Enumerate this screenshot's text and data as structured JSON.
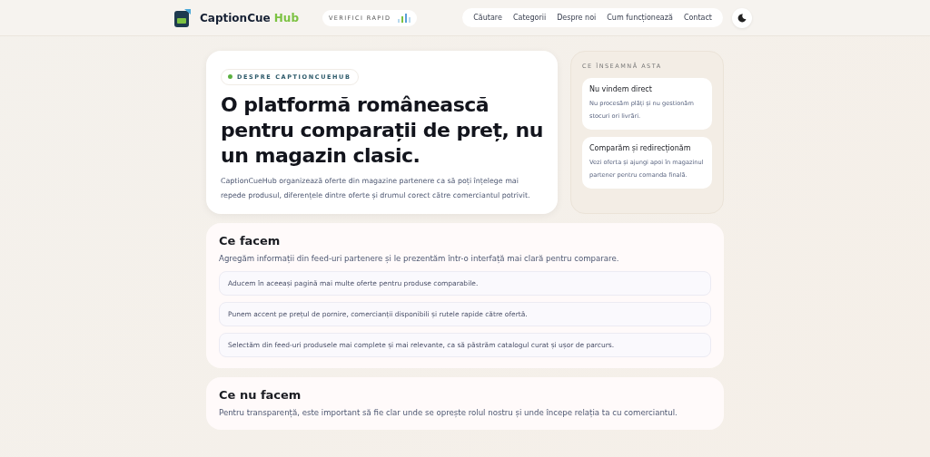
{
  "header": {
    "brand": {
      "name": "CaptionCue",
      "accent": "Hub"
    },
    "badge": "VERIFICI RAPID",
    "nav": [
      {
        "label": "Căutare"
      },
      {
        "label": "Categorii"
      },
      {
        "label": "Despre noi"
      },
      {
        "label": "Cum funcționează"
      },
      {
        "label": "Contact"
      }
    ]
  },
  "hero": {
    "eyebrow": "DESPRE CAPTIONCUEHUB",
    "title": "O platformă românească pentru comparații de preț, nu un magazin clasic.",
    "text": "CaptionCueHub organizează oferte din magazine partenere ca să poți înțelege mai repede produsul, diferențele dintre oferte și drumul corect către comerciantul potrivit."
  },
  "aside": {
    "label": "CE ÎNSEAMNĂ ASTA",
    "cards": [
      {
        "title": "Nu vindem direct",
        "text": "Nu procesăm plăți și nu gestionăm stocuri ori livrări."
      },
      {
        "title": "Comparăm și redirecționăm",
        "text": "Vezi oferta și ajungi apoi în magazinul partener pentru comanda finală."
      }
    ]
  },
  "sections": [
    {
      "title": "Ce facem",
      "text": "Agregăm informații din feed-uri partenere și le prezentăm într-o interfață mai clară pentru comparare.",
      "items": [
        "Aducem în aceeași pagină mai multe oferte pentru produse comparabile.",
        "Punem accent pe prețul de pornire, comercianții disponibili și rutele rapide către ofertă.",
        "Selectăm din feed-uri produsele mai complete și mai relevante, ca să păstrăm catalogul curat și ușor de parcurs."
      ]
    },
    {
      "title": "Ce nu facem",
      "text": "Pentru transparență, este important să fie clar unde se oprește rolul nostru și unde începe relația ta cu comerciantul."
    }
  ]
}
